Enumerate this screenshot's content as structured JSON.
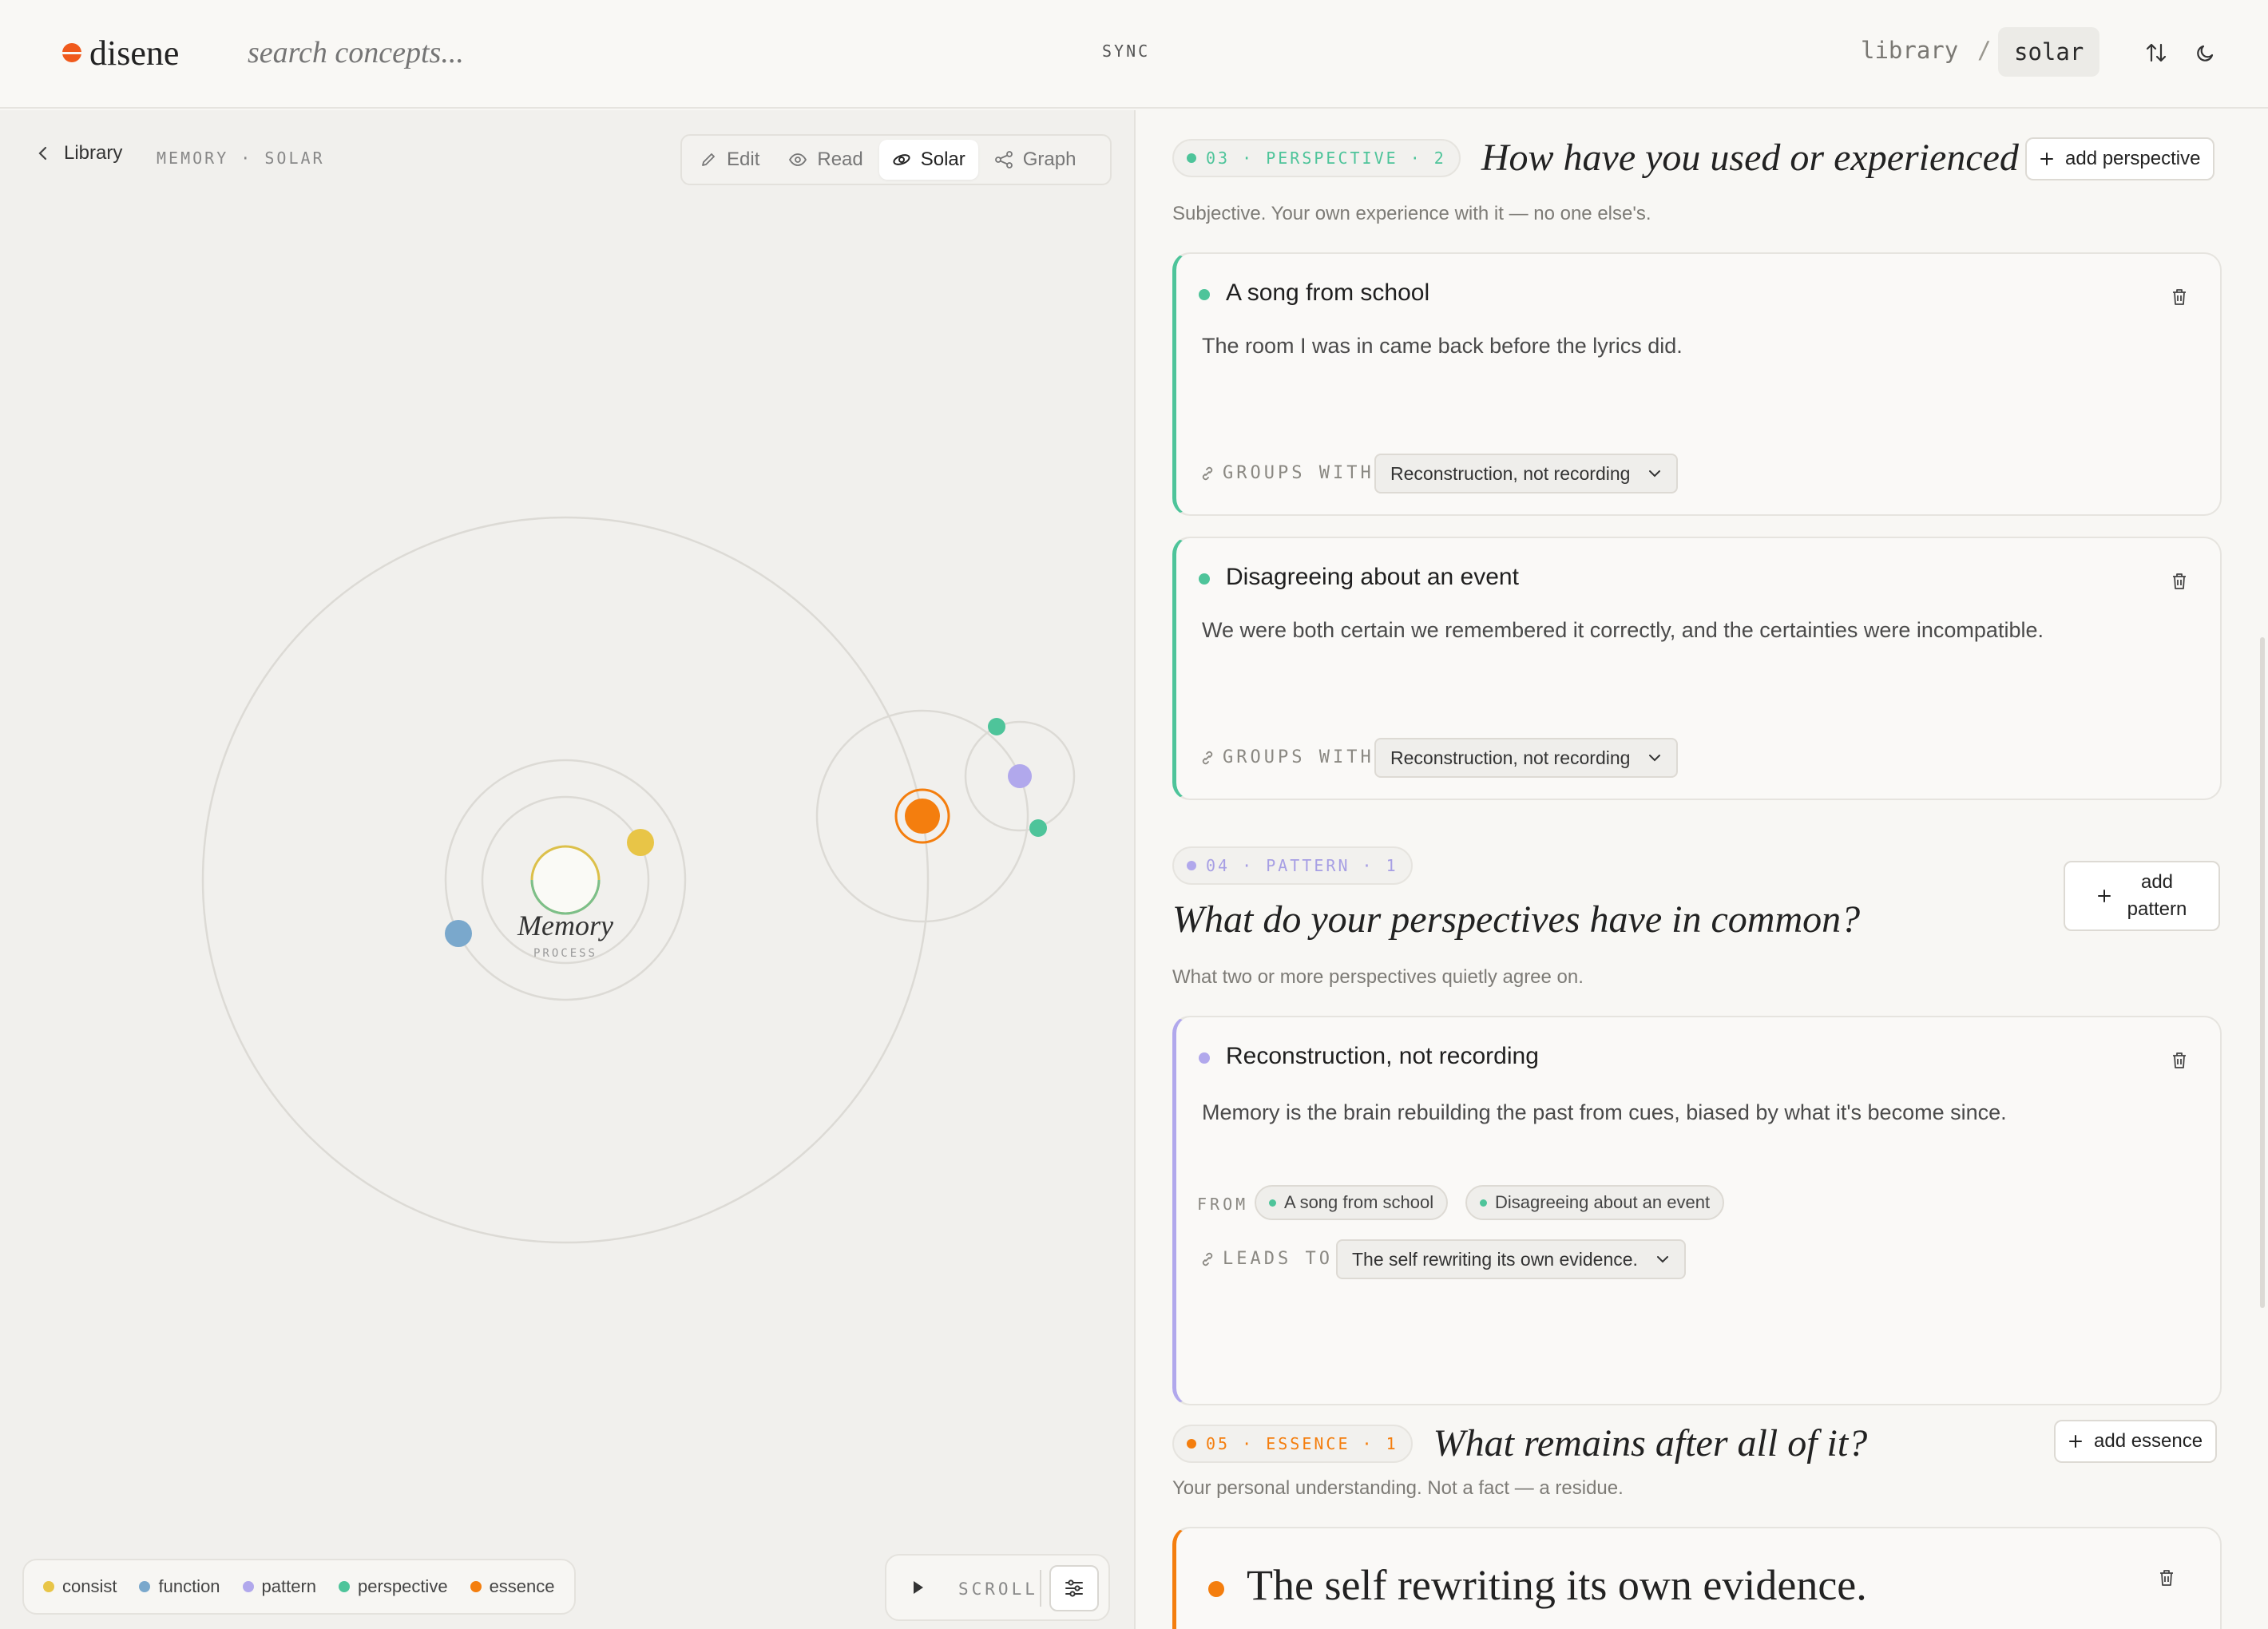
{
  "app": {
    "brand": "disene",
    "search_placeholder": "search concepts...",
    "sync_label": "SYNC",
    "breadcrumb": {
      "root": "library",
      "separator": "/",
      "current": "solar"
    }
  },
  "left_panel": {
    "back_label": "Library",
    "crumb": "MEMORY · SOLAR",
    "modes": [
      {
        "label": "Edit",
        "icon": "pencil-icon",
        "active": false
      },
      {
        "label": "Read",
        "icon": "eye-icon",
        "active": false
      },
      {
        "label": "Solar",
        "icon": "orbit-icon",
        "active": true
      },
      {
        "label": "Graph",
        "icon": "share-graph-icon",
        "active": false
      }
    ],
    "solar": {
      "center_label": "Memory",
      "center_sublabel": "PROCESS"
    },
    "legend": [
      {
        "label": "consist",
        "color": "#e8c547"
      },
      {
        "label": "function",
        "color": "#7aa8cc"
      },
      {
        "label": "pattern",
        "color": "#b1a8ec"
      },
      {
        "label": "perspective",
        "color": "#4ec49a"
      },
      {
        "label": "essence",
        "color": "#f47e0e"
      }
    ],
    "scroll_label": "SCROLL"
  },
  "right_panel": {
    "perspective": {
      "pill": "03 · PERSPECTIVE · 2",
      "color": "#4ec49a",
      "title": "How have you used or experienced it?",
      "subtitle": "Subjective. Your own experience with it — no one else's.",
      "add_label": "add perspective",
      "cards": [
        {
          "title": "A song from school",
          "body": "The room I was in came back before the lyrics did.",
          "groups_label": "GROUPS WITH",
          "groups_value": "Reconstruction, not recording"
        },
        {
          "title": "Disagreeing about an event",
          "body": "We were both certain we remembered it correctly, and the certainties were incompatible.",
          "groups_label": "GROUPS WITH",
          "groups_value": "Reconstruction, not recording"
        }
      ]
    },
    "pattern": {
      "pill": "04 · PATTERN · 1",
      "color": "#b1a8ec",
      "title": "What do your perspectives have in common?",
      "subtitle": "What two or more perspectives quietly agree on.",
      "add_label_line1": "add",
      "add_label_line2": "pattern",
      "card": {
        "title": "Reconstruction, not recording",
        "body": "Memory is the brain rebuilding the past from cues, biased by what it's become since.",
        "from_label": "FROM",
        "from_chips": [
          "A song from school",
          "Disagreeing about an event"
        ],
        "leads_label": "LEADS TO",
        "leads_value": "The self rewriting its own evidence."
      }
    },
    "essence": {
      "pill": "05 · ESSENCE · 1",
      "color": "#f47e0e",
      "title": "What remains after all of it?",
      "subtitle": "Your personal understanding. Not a fact — a residue.",
      "add_label": "add essence",
      "card": {
        "title": "The self rewriting its own evidence."
      }
    }
  }
}
